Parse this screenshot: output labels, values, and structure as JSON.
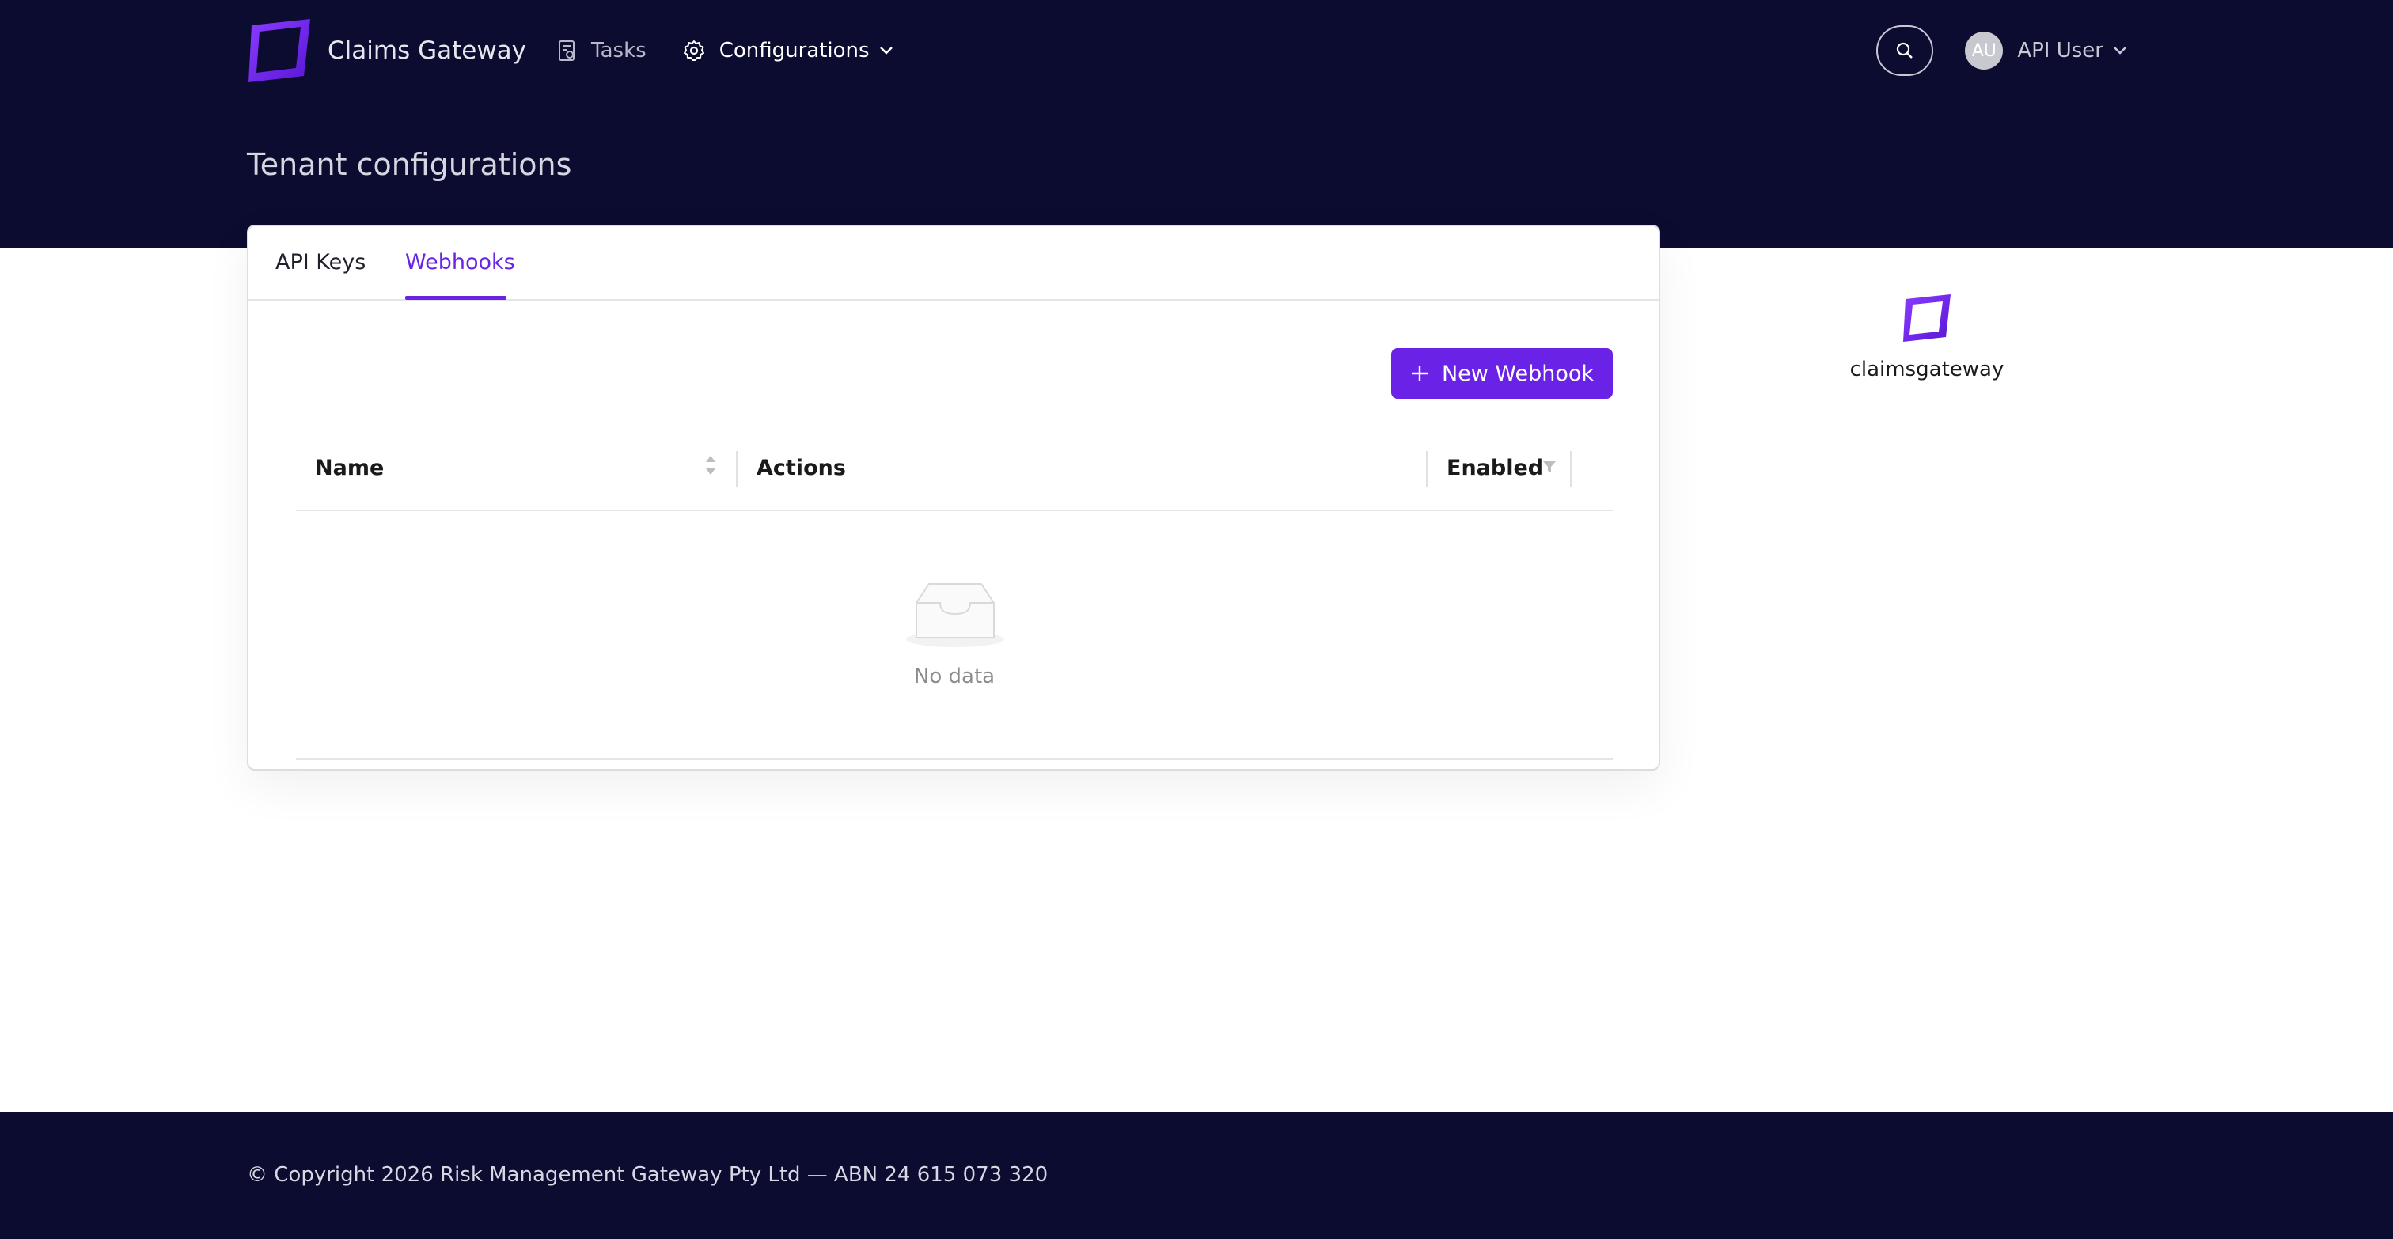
{
  "app": {
    "brand": "Claims Gateway",
    "logo_icon": "claims-gateway-logo-icon",
    "accent_color": "#6a22e6",
    "header_bg": "#0c0c31"
  },
  "nav": {
    "items": [
      {
        "label": "Tasks",
        "icon": "clipboard-icon"
      },
      {
        "label": "Configurations",
        "icon": "gear-icon",
        "has_dropdown": true
      }
    ],
    "search_icon": "search-icon",
    "user": {
      "initials": "AU",
      "name": "API User"
    }
  },
  "page": {
    "title": "Tenant configurations"
  },
  "tabs": [
    {
      "label": "API Keys",
      "active": false
    },
    {
      "label": "Webhooks",
      "active": true
    }
  ],
  "toolbar": {
    "new_label": "New Webhook"
  },
  "table": {
    "columns": [
      {
        "label": "Name",
        "sortable": true
      },
      {
        "label": "Actions"
      },
      {
        "label": "Enabled",
        "filterable": true
      }
    ],
    "rows": [],
    "empty_text": "No data"
  },
  "tenant": {
    "name": "claimsgateway"
  },
  "footer": {
    "text": "© Copyright 2026 Risk Management Gateway Pty Ltd — ABN 24 615 073 320"
  }
}
